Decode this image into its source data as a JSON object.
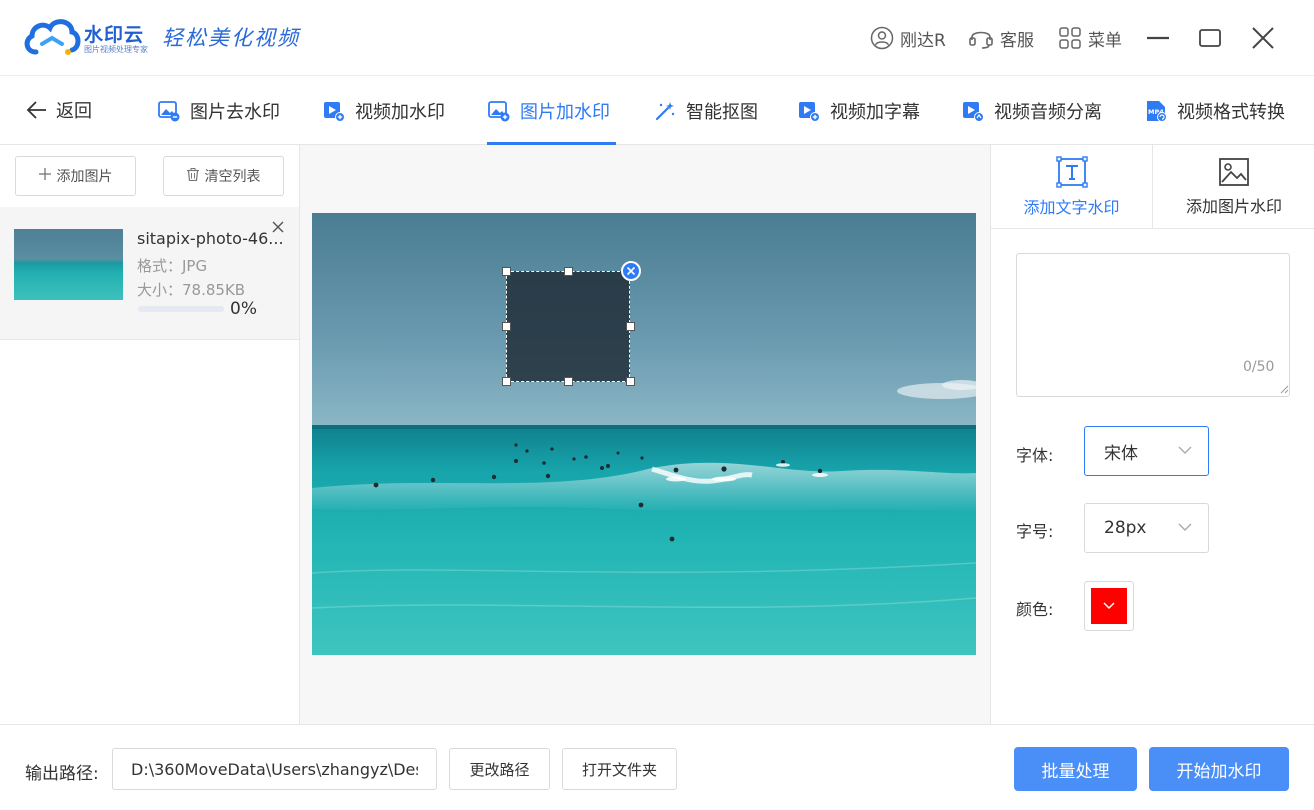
{
  "app": {
    "name": "水印云",
    "subtitle": "图片视频处理专家",
    "slogan": "轻松美化视频"
  },
  "titlebar": {
    "user_name": "刚达R",
    "service_label": "客服",
    "menu_label": "菜单"
  },
  "nav": {
    "back_label": "返回",
    "tabs": [
      {
        "label": "图片去水印",
        "icon": "image-remove-icon"
      },
      {
        "label": "视频加水印",
        "icon": "video-add-icon"
      },
      {
        "label": "图片加水印",
        "icon": "image-add-icon",
        "active": true
      },
      {
        "label": "智能抠图",
        "icon": "magic-wand-icon"
      },
      {
        "label": "视频加字幕",
        "icon": "video-subtitle-icon"
      },
      {
        "label": "视频音频分离",
        "icon": "video-audio-split-icon"
      },
      {
        "label": "视频格式转换",
        "icon": "mp4-file-icon",
        "badge": "MP4"
      }
    ]
  },
  "left_panel": {
    "add_label": "添加图片",
    "clear_label": "清空列表",
    "files": [
      {
        "name": "sitapix-photo-46...",
        "format": "格式：JPG",
        "size": "大小：78.85KB",
        "progress": 0,
        "progress_text": "0%"
      }
    ]
  },
  "right_panel": {
    "tab_text": "添加文字水印",
    "tab_image": "添加图片水印",
    "text_value": "",
    "char_count": "0/50",
    "font_label": "字体:",
    "font_value": "宋体",
    "size_label": "字号:",
    "size_value": "28px",
    "color_label": "颜色:",
    "color_value": "#ff0000"
  },
  "bottom": {
    "output_label": "输出路径:",
    "output_path": "D:\\360MoveData\\Users\\zhangyz\\Des",
    "change_path_label": "更改路径",
    "open_folder_label": "打开文件夹",
    "batch_label": "批量处理",
    "start_label": "开始加水印"
  },
  "colors": {
    "accent": "#2f7bf5",
    "primary_button": "#4a8ff7"
  }
}
